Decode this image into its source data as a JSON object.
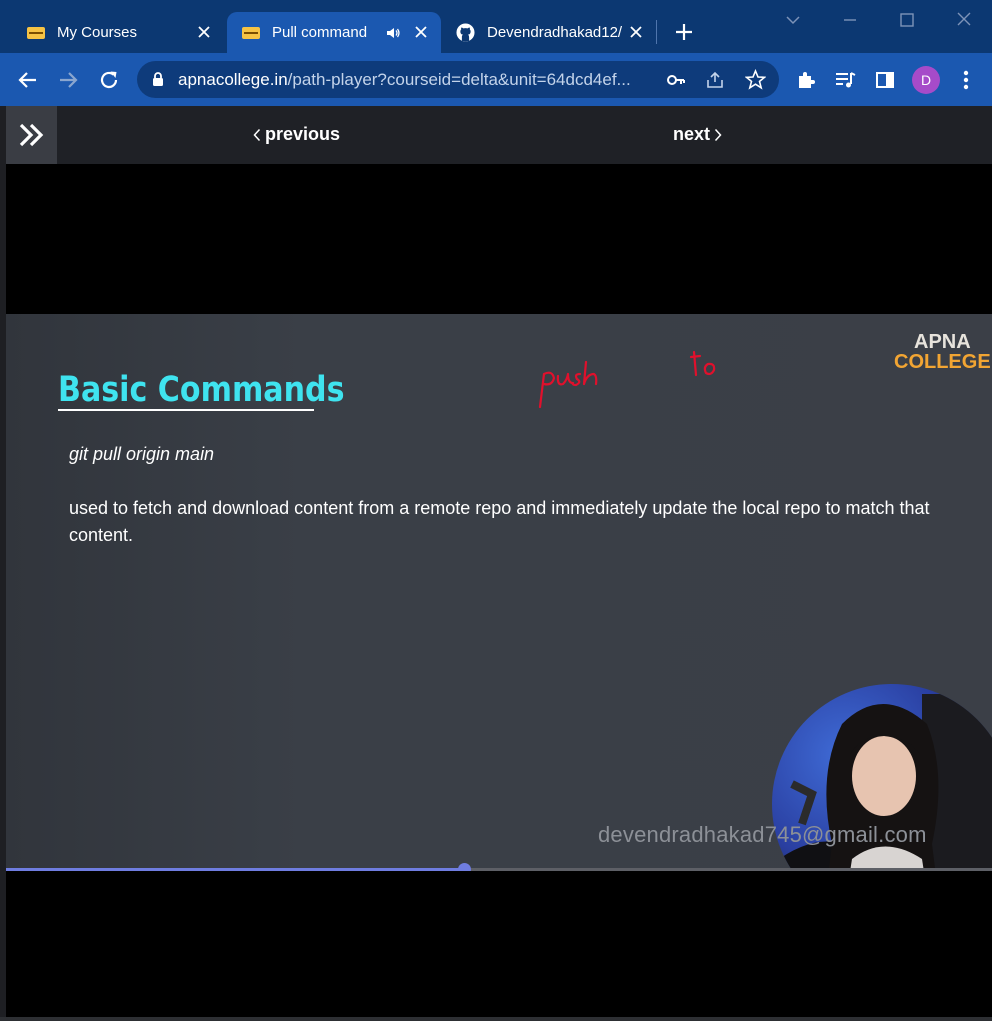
{
  "browser": {
    "tabs": [
      {
        "title": "My Courses",
        "favicon": "apna-college-favicon",
        "active": false
      },
      {
        "title": "Pull command",
        "favicon": "apna-college-favicon",
        "active": true,
        "audio": true
      },
      {
        "title": "Devendradhakad12/",
        "favicon": "github-icon",
        "active": false
      }
    ],
    "url_host": "apnacollege.in",
    "url_path": "/path-player?courseid=delta&unit=64dcd4ef...",
    "profile_initial": "D",
    "colors": {
      "tabbar": "#0c3872",
      "active_tab": "#1b58b0",
      "omnibox": "#0e3b7b",
      "avatar": "#a64bc9"
    }
  },
  "player": {
    "prev_label": "previous",
    "next_label": "next",
    "progress_fraction": 0.465
  },
  "slide": {
    "title": "Basic Commands",
    "command": "git pull origin main",
    "description": "used to fetch and download content from a remote repo and immediately update the local repo to match that content.",
    "logo_line1": "APNA",
    "logo_line2": "COLLEGE",
    "watermark": "devendradhakad745@gmail.com",
    "colors": {
      "title": "#3fe3ef",
      "logo_accent": "#f2a533",
      "ink": "#e0102c",
      "progress": "#6f7de0"
    }
  }
}
